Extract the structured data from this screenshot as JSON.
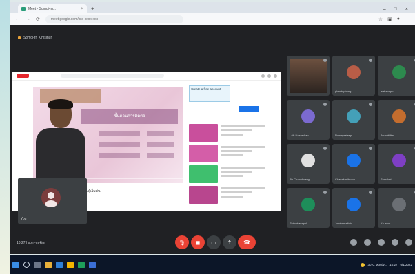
{
  "browser": {
    "tab_title": "Meet - Somoi-rn...",
    "tab_close": "×",
    "new_tab": "+",
    "window_controls": [
      "–",
      "□",
      "×"
    ],
    "url": "meet.google.com/xxx-xxxx-xxx",
    "toolbar_icons": [
      "back-arrow-icon",
      "forward-arrow-icon",
      "reload-icon",
      "info-icon",
      "extensions-icon",
      "profile-icon",
      "menu-icon"
    ]
  },
  "meeting": {
    "title": "Somoi-rn Kimsinun",
    "time_label": "10:27 | som-rn-kim",
    "presentation": {
      "slide_heading": "ขั้นตอนการติดต่อ",
      "caption": "ขั้นตอนการติดต่อ ฝึกหัดเรียนรู้สำหรับผู้เริ่มต้น",
      "ad_text": "Create a free account",
      "progress_percent": 32
    },
    "self_view_name": "You",
    "participants": [
      {
        "name": "",
        "type": "photo",
        "color": "#6d5140"
      },
      {
        "name": "phantuphong",
        "type": "avatar",
        "color": "#b85d47"
      },
      {
        "name": "wattanapo",
        "type": "avatar",
        "color": "#2d8a4e"
      },
      {
        "name": "Lalit Nasraskah",
        "type": "avatar",
        "color": "#7b6ad0"
      },
      {
        "name": "Namaprateep",
        "type": "avatar",
        "color": "#44a0b8"
      },
      {
        "name": "Jorawittika",
        "type": "avatar",
        "color": "#c46d2e"
      },
      {
        "name": "Jin Chanukuang",
        "type": "avatar",
        "color": "#e0e0e0"
      },
      {
        "name": "Chanakanitsona",
        "type": "avatar",
        "color": "#1a73e8"
      },
      {
        "name": "Somchai",
        "type": "avatar",
        "color": "#7e3fc4"
      },
      {
        "name": "Siriwattanapol",
        "type": "avatar",
        "color": "#1e8e5a"
      },
      {
        "name": "Jomintaratich",
        "type": "avatar",
        "color": "#1a73e8"
      },
      {
        "name": "Ke-erup",
        "type": "avatar",
        "color": "#6b6f74"
      }
    ]
  },
  "controls": {
    "mic": "mic-off-icon",
    "camera": "camera-off-icon",
    "captions": "captions-icon",
    "present": "present-icon",
    "more": "more-vert-icon",
    "end_call": "end-call-icon",
    "right_icons": [
      "info-icon",
      "people-icon",
      "chat-icon",
      "activities-icon",
      "lock-icon"
    ]
  },
  "taskbar": {
    "tray_weather": "30°C Mostly...",
    "tray_time": "10:27",
    "tray_date": "6/1/2022"
  }
}
